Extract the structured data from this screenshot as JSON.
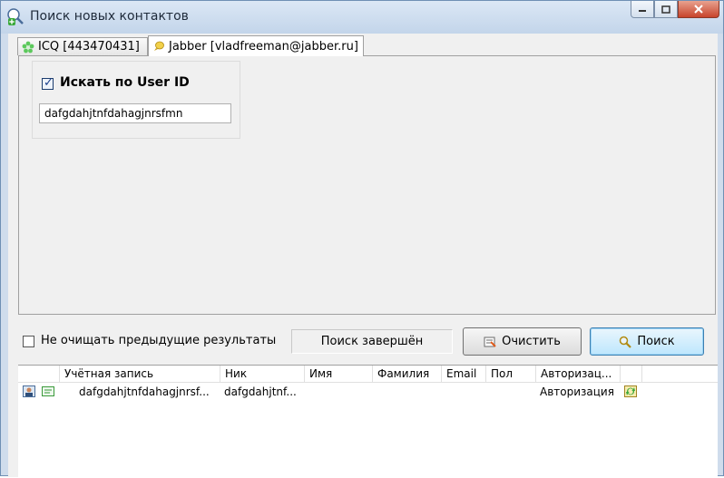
{
  "window": {
    "title": "Поиск новых контактов"
  },
  "tabs": [
    {
      "label": "ICQ [443470431]",
      "icon": "icq-flower-icon",
      "active": false
    },
    {
      "label": "Jabber [vladfreeman@jabber.ru]",
      "icon": "jabber-bulb-icon",
      "active": true
    }
  ],
  "search": {
    "by_user_id_label": "Искать по User ID",
    "by_user_id_checked": true,
    "user_id_value": "dafgdahjtnfdahagjnrsfmn"
  },
  "controls": {
    "keep_results_label": "Не очищать предыдущие результаты",
    "keep_results_checked": false,
    "status_text": "Поиск завершён",
    "clear_label": "Очистить",
    "search_label": "Поиск"
  },
  "results": {
    "columns": [
      "Учётная запись",
      "Ник",
      "Имя",
      "Фамилия",
      "Email",
      "Пол",
      "Авторизац..."
    ],
    "rows": [
      {
        "account": "dafgdahjtnfdahagjnrsf...",
        "nick": "dafgdahjtnf...",
        "first_name": "",
        "last_name": "",
        "email": "",
        "gender": "",
        "auth": "Авторизация"
      }
    ]
  },
  "colors": {
    "accent": "#3c7fb1",
    "title_bar": "#c3d5ea",
    "close_button": "#c8442c"
  }
}
